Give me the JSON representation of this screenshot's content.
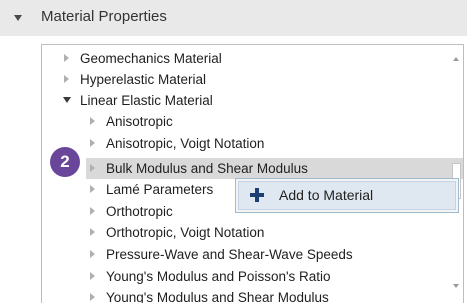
{
  "header": {
    "title": "Material Properties"
  },
  "tree": {
    "items": [
      {
        "label": "Geomechanics Material",
        "level": 0,
        "state": "collapsed"
      },
      {
        "label": "Hyperelastic Material",
        "level": 0,
        "state": "collapsed"
      },
      {
        "label": "Linear Elastic Material",
        "level": 0,
        "state": "expanded"
      },
      {
        "label": "Anisotropic",
        "level": 1,
        "state": "collapsed"
      },
      {
        "label": "Anisotropic, Voigt Notation",
        "level": 1,
        "state": "collapsed"
      },
      {
        "label": "Bulk Modulus and Shear Modulus",
        "level": 1,
        "state": "collapsed",
        "selected": true
      },
      {
        "label": "Lamé Parameters",
        "level": 1,
        "state": "collapsed"
      },
      {
        "label": "Orthotropic",
        "level": 1,
        "state": "collapsed"
      },
      {
        "label": "Orthotropic, Voigt Notation",
        "level": 1,
        "state": "collapsed"
      },
      {
        "label": "Pressure-Wave and Shear-Wave Speeds",
        "level": 1,
        "state": "collapsed"
      },
      {
        "label": "Young's Modulus and Poisson's Ratio",
        "level": 1,
        "state": "collapsed"
      },
      {
        "label": "Young's Modulus and Shear Modulus",
        "level": 1,
        "state": "collapsed"
      }
    ]
  },
  "step_badge": "2",
  "context_menu": {
    "items": [
      {
        "label": "Add to Material",
        "icon": "plus-icon"
      }
    ]
  },
  "colors": {
    "badge": "#6a469b",
    "selection": "#d9d9d9",
    "menu_highlight": "#dfe8f0",
    "plus": "#1c3f73"
  }
}
